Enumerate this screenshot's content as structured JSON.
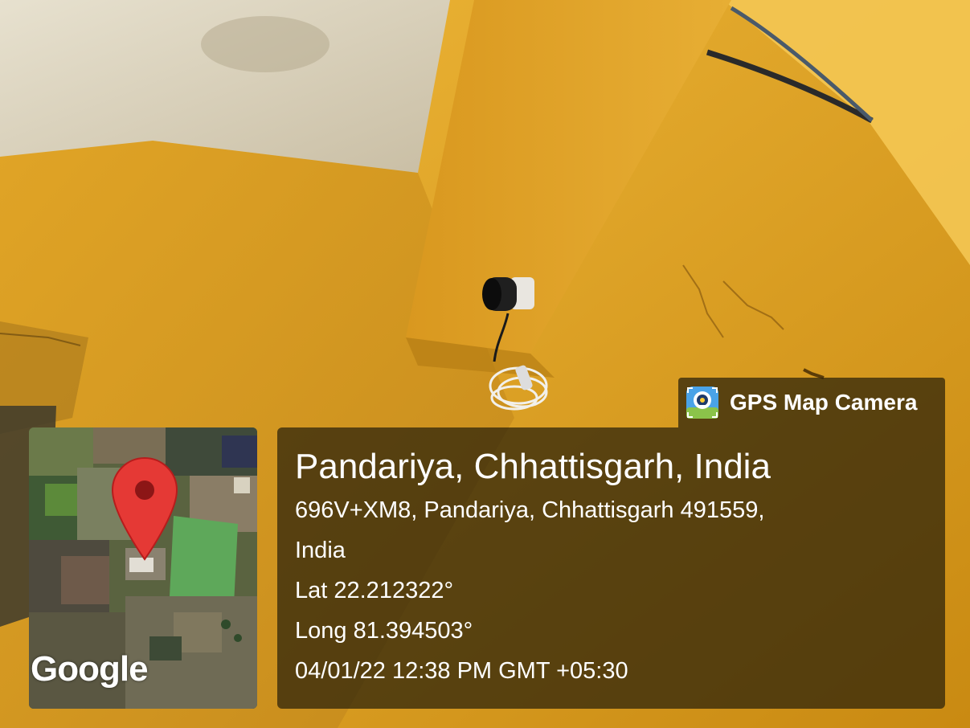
{
  "app_badge": {
    "name": "GPS Map Camera",
    "icon": "gps-map-camera-logo"
  },
  "map": {
    "provider_logo_text": "Google",
    "pin_icon": "map-pin-icon"
  },
  "location": {
    "place": "Pandariya, Chhattisgarh, India",
    "address_line1": "696V+XM8, Pandariya, Chhattisgarh 491559,",
    "address_line2": "India",
    "latitude": "Lat 22.212322°",
    "longitude": "Long 81.394503°",
    "datetime": "04/01/22 12:38 PM GMT +05:30"
  },
  "colors": {
    "wall_yellow": "#e2a51e",
    "ceiling_white": "#ddd6c3",
    "pin_red": "#e53935",
    "overlay": "#28200a"
  }
}
